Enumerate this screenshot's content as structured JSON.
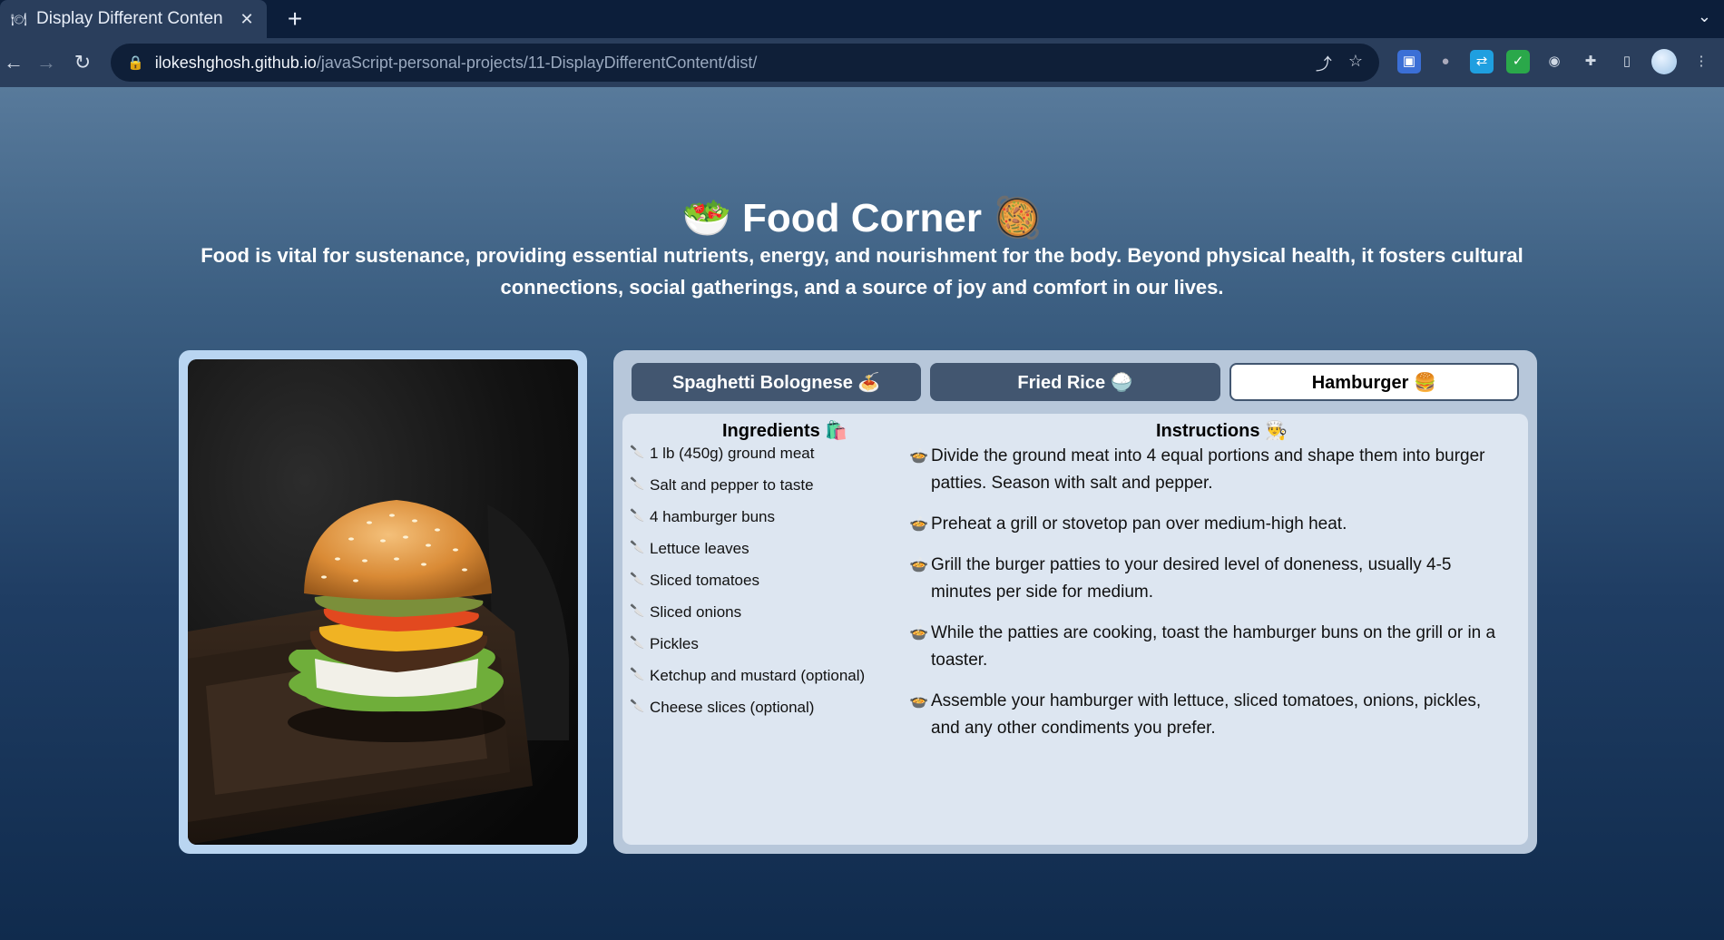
{
  "browser": {
    "tab_title": "Display Different Conten",
    "tab_favicon": "🍽",
    "new_tab": "+",
    "url_host": "ilokeshghosh.github.io",
    "url_path": "/javaScript-personal-projects/11-DisplayDifferentContent/dist/",
    "icons": [
      "back-icon",
      "forward-icon",
      "reload-icon",
      "lock-icon",
      "share-icon",
      "star-icon",
      "extension-icon",
      "sidebar-icon",
      "avatar"
    ]
  },
  "page": {
    "title": "🥗 Food Corner 🥘",
    "intro": "Food is vital for sustenance, providing essential nutrients, energy, and nourishment for the body. Beyond physical health, it fosters cultural connections, social gatherings, and a source of joy and comfort in our lives."
  },
  "tabs": [
    {
      "label": "Spaghetti Bolognese 🍝",
      "active": false
    },
    {
      "label": "Fried Rice 🍚",
      "active": false
    },
    {
      "label": "Hamburger 🍔",
      "active": true
    }
  ],
  "ingredients": {
    "title": "Ingredients 🛍️",
    "items": [
      "1 lb (450g) ground meat",
      "Salt and pepper to taste",
      "4 hamburger buns",
      "Lettuce leaves",
      "Sliced tomatoes",
      "Sliced onions",
      "Pickles",
      "Ketchup and mustard (optional)",
      "Cheese slices (optional)"
    ]
  },
  "instructions": {
    "title": "Instructions 👨‍🍳",
    "steps": [
      "Divide the ground meat into 4 equal portions and shape them into burger patties. Season with salt and pepper.",
      "Preheat a grill or stovetop pan over medium-high heat.",
      "Grill the burger patties to your desired level of doneness, usually 4-5 minutes per side for medium.",
      "While the patties are cooking, toast the hamburger buns on the grill or in a toaster.",
      "Assemble your hamburger with lettuce, sliced tomatoes, onions, pickles, and any other condiments you prefer."
    ]
  },
  "colors": {
    "tab_active_bg": "#ffffff",
    "tab_inactive_bg": "#425670",
    "card_bg": "#b7c7da",
    "content_bg": "#dde6f1"
  }
}
